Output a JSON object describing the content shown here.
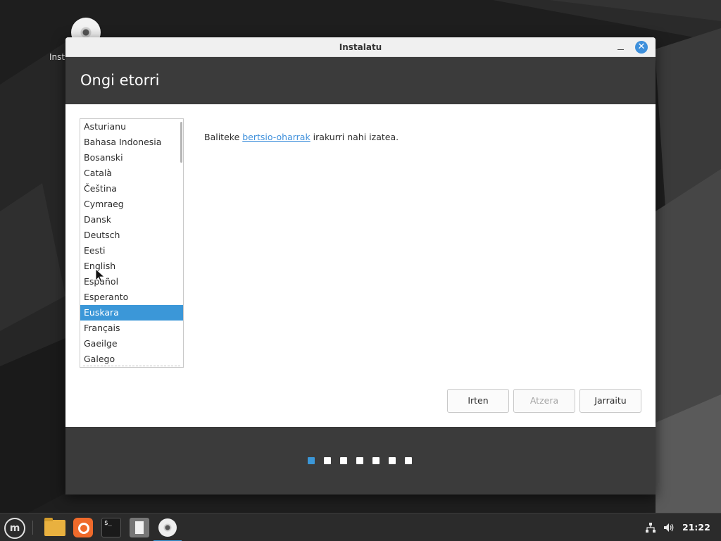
{
  "desktop": {
    "icon_label": "Inst"
  },
  "window": {
    "title": "Instalatu",
    "close_glyph": "✕",
    "header_title": "Ongi etorri"
  },
  "languages": {
    "items": [
      "Asturianu",
      "Bahasa Indonesia",
      "Bosanski",
      "Català",
      "Čeština",
      "Cymraeg",
      "Dansk",
      "Deutsch",
      "Eesti",
      "English",
      "Español",
      "Esperanto",
      "Euskara",
      "Français",
      "Gaeilge",
      "Galego"
    ],
    "selected": "Euskara"
  },
  "note": {
    "before": "Baliteke ",
    "link": "bertsio-oharrak",
    "after": " irakurri nahi izatea."
  },
  "buttons": {
    "quit": "Irten",
    "back": "Atzera",
    "continue": "Jarraitu"
  },
  "progress": {
    "total_steps": 7,
    "current_step": 1
  },
  "taskbar": {
    "menu_glyph": "m",
    "terminal_glyph": "$_",
    "clock": "21:22"
  },
  "colors": {
    "accent": "#3b97d8",
    "header": "#3b3b3b"
  }
}
